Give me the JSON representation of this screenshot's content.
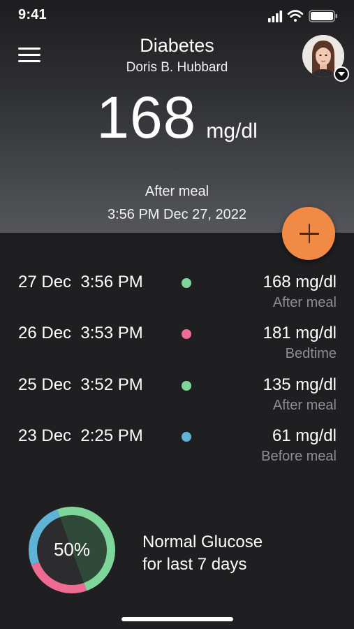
{
  "status_bar": {
    "time": "9:41"
  },
  "header": {
    "title": "Diabetes",
    "subtitle": "Doris B. Hubbard",
    "reading_value": "168",
    "reading_unit": "mg/dl",
    "meal_label": "After meal",
    "reading_time": "3:56 PM Dec 27, 2022"
  },
  "icons": {
    "menu": "hamburger-menu-icon",
    "add": "plus-icon",
    "avatar": "user-avatar",
    "caret": "chevron-down-icon"
  },
  "colors": {
    "normal": "#7ed69b",
    "high": "#ee6b94",
    "low": "#5fb4d6",
    "accent": "#f08a45"
  },
  "entries": [
    {
      "date": "27 Dec  3:56 PM",
      "value": "168 mg/dl",
      "meal": "After meal",
      "status": "normal"
    },
    {
      "date": "26 Dec  3:53 PM",
      "value": "181 mg/dl",
      "meal": "Bedtime",
      "status": "high"
    },
    {
      "date": "25 Dec  3:52 PM",
      "value": "135 mg/dl",
      "meal": "After meal",
      "status": "normal"
    },
    {
      "date": "23 Dec  2:25 PM",
      "value": "61 mg/dl",
      "meal": "Before meal",
      "status": "low"
    }
  ],
  "summary": {
    "percent_label": "50%",
    "line1": "Normal Glucose",
    "line2": "for last 7 days",
    "ring_fractions": {
      "normal": 0.5,
      "high": 0.25,
      "low": 0.25
    }
  }
}
